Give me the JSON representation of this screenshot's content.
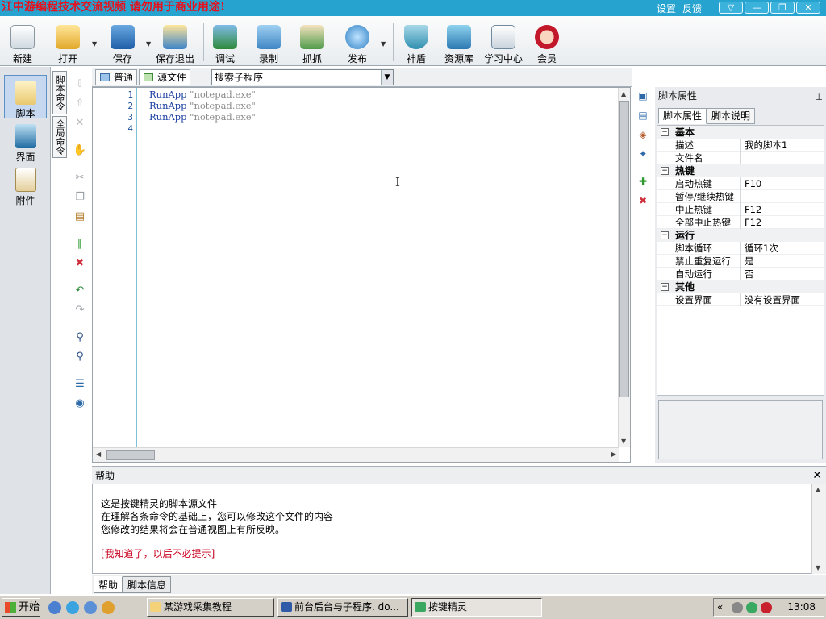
{
  "window": {
    "title": "江中游编程技术交流视频 请勿用于商业用途!",
    "settings": "设置",
    "feedback": "反馈",
    "controls": [
      "▽",
      "—",
      "❐",
      "✕"
    ]
  },
  "toolbar": {
    "buttons": [
      {
        "label": "新建",
        "icon": "new-file-icon"
      },
      {
        "label": "打开",
        "icon": "open-folder-icon"
      },
      {
        "label": "保存",
        "icon": "save-disk-icon"
      },
      {
        "label": "保存退出",
        "icon": "save-exit-icon"
      },
      {
        "label": "调试",
        "icon": "debug-icon"
      },
      {
        "label": "录制",
        "icon": "record-camera-icon"
      },
      {
        "label": "抓抓",
        "icon": "grab-hand-icon"
      },
      {
        "label": "发布",
        "icon": "publish-globe-icon"
      },
      {
        "label": "神盾",
        "icon": "shield-icon"
      },
      {
        "label": "资源库",
        "icon": "resource-library-icon"
      },
      {
        "label": "学习中心",
        "icon": "learning-center-icon"
      },
      {
        "label": "会员",
        "icon": "member-avatar-icon"
      }
    ]
  },
  "leftnav": {
    "items": [
      {
        "label": "脚本",
        "icon": "script-icon"
      },
      {
        "label": "界面",
        "icon": "interface-icon"
      },
      {
        "label": "附件",
        "icon": "attachment-icon"
      }
    ]
  },
  "vtabs": [
    "脚本命令",
    "全局命令"
  ],
  "editor": {
    "tabs": [
      "普通",
      "源文件"
    ],
    "subroutine_search": "搜索子程序",
    "lines": [
      {
        "n": "1",
        "kw": "RunApp",
        "arg": "\"notepad.exe\""
      },
      {
        "n": "2",
        "kw": "RunApp",
        "arg": "\"notepad.exe\""
      },
      {
        "n": "3",
        "kw": "RunApp",
        "arg": "\"notepad.exe\""
      },
      {
        "n": "4",
        "kw": "",
        "arg": ""
      }
    ]
  },
  "properties": {
    "title": "脚本属性",
    "tabs": [
      "脚本属性",
      "脚本说明"
    ],
    "groups": [
      {
        "name": "基本",
        "rows": [
          [
            "描述",
            "我的脚本1"
          ],
          [
            "文件名",
            ""
          ]
        ]
      },
      {
        "name": "热键",
        "rows": [
          [
            "启动热键",
            "F10"
          ],
          [
            "暂停/继续热键",
            ""
          ],
          [
            "中止热键",
            "F12"
          ],
          [
            "全部中止热键",
            "F12"
          ]
        ]
      },
      {
        "name": "运行",
        "rows": [
          [
            "脚本循环",
            "循环1次"
          ],
          [
            "禁止重复运行",
            "是"
          ],
          [
            "自动运行",
            "否"
          ]
        ]
      },
      {
        "name": "其他",
        "rows": [
          [
            "设置界面",
            "没有设置界面"
          ]
        ]
      }
    ]
  },
  "help": {
    "title": "帮助",
    "lines": [
      "这是按键精灵的脚本源文件",
      "在理解各条命令的基础上，您可以修改这个文件的内容",
      "您修改的结果将会在普通视图上有所反映。"
    ],
    "link": "[我知道了，以后不必提示]",
    "tabs": [
      "帮助",
      "脚本信息"
    ]
  },
  "taskbar": {
    "start": "开始",
    "tasks": [
      "某游戏采集教程",
      "前台后台与子程序. do...",
      "按键精灵"
    ],
    "clock": "13:08",
    "tray_chevron": "«"
  }
}
